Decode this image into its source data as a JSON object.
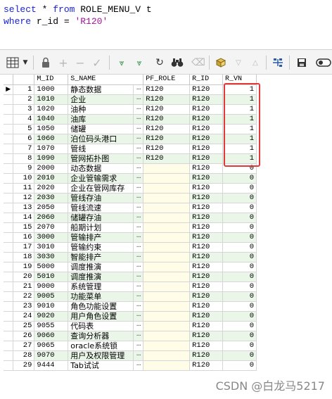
{
  "editor": {
    "line1": {
      "kw1": "select",
      "mid": " * ",
      "kw2": "from",
      "rest": " ROLE_MENU_V t"
    },
    "line2": {
      "kw1": "where",
      "mid": " r_id = ",
      "str": "'R120'"
    }
  },
  "toolbar": {
    "icons": [
      "grid-icon",
      "lock-icon",
      "add-row-icon",
      "delete-row-icon",
      "post-icon",
      "first-record-icon",
      "last-record-icon",
      "refresh-icon",
      "find-icon",
      "clear-icon",
      "export-icon",
      "move-down-icon",
      "move-up-icon",
      "query-plan-icon",
      "save-icon",
      "switch-icon"
    ]
  },
  "grid": {
    "columns": [
      "M_ID",
      "S_NAME",
      "PF_ROLE",
      "R_ID",
      "R_VN"
    ],
    "dots": "···",
    "rows": [
      {
        "n": "1",
        "m_id": "1000",
        "s_name": "静态数据",
        "pf_role": "R120",
        "r_id": "R120",
        "r_vn": "1"
      },
      {
        "n": "2",
        "m_id": "1010",
        "s_name": "企业",
        "pf_role": "R120",
        "r_id": "R120",
        "r_vn": "1"
      },
      {
        "n": "3",
        "m_id": "1020",
        "s_name": "油种",
        "pf_role": "R120",
        "r_id": "R120",
        "r_vn": "1"
      },
      {
        "n": "4",
        "m_id": "1040",
        "s_name": "油库",
        "pf_role": "R120",
        "r_id": "R120",
        "r_vn": "1"
      },
      {
        "n": "5",
        "m_id": "1050",
        "s_name": "储罐",
        "pf_role": "R120",
        "r_id": "R120",
        "r_vn": "1"
      },
      {
        "n": "6",
        "m_id": "1060",
        "s_name": "泊位码头港口",
        "pf_role": "R120",
        "r_id": "R120",
        "r_vn": "1"
      },
      {
        "n": "7",
        "m_id": "1070",
        "s_name": "管线",
        "pf_role": "R120",
        "r_id": "R120",
        "r_vn": "1"
      },
      {
        "n": "8",
        "m_id": "1090",
        "s_name": "管网拓扑图",
        "pf_role": "R120",
        "r_id": "R120",
        "r_vn": "1"
      },
      {
        "n": "9",
        "m_id": "2000",
        "s_name": "动态数据",
        "pf_role": "",
        "r_id": "R120",
        "r_vn": "0"
      },
      {
        "n": "10",
        "m_id": "2010",
        "s_name": "企业管输需求",
        "pf_role": "",
        "r_id": "R120",
        "r_vn": "0"
      },
      {
        "n": "11",
        "m_id": "2020",
        "s_name": "企业在管网库存",
        "pf_role": "",
        "r_id": "R120",
        "r_vn": "0"
      },
      {
        "n": "12",
        "m_id": "2030",
        "s_name": "管线存油",
        "pf_role": "",
        "r_id": "R120",
        "r_vn": "0"
      },
      {
        "n": "13",
        "m_id": "2050",
        "s_name": "管线流速",
        "pf_role": "",
        "r_id": "R120",
        "r_vn": "0"
      },
      {
        "n": "14",
        "m_id": "2060",
        "s_name": "储罐存油",
        "pf_role": "",
        "r_id": "R120",
        "r_vn": "0"
      },
      {
        "n": "15",
        "m_id": "2070",
        "s_name": "船期计划",
        "pf_role": "",
        "r_id": "R120",
        "r_vn": "0"
      },
      {
        "n": "16",
        "m_id": "3000",
        "s_name": "管输排产",
        "pf_role": "",
        "r_id": "R120",
        "r_vn": "0"
      },
      {
        "n": "17",
        "m_id": "3010",
        "s_name": "管输约束",
        "pf_role": "",
        "r_id": "R120",
        "r_vn": "0"
      },
      {
        "n": "18",
        "m_id": "3030",
        "s_name": "智能排产",
        "pf_role": "",
        "r_id": "R120",
        "r_vn": "0"
      },
      {
        "n": "19",
        "m_id": "5000",
        "s_name": "调度推演",
        "pf_role": "",
        "r_id": "R120",
        "r_vn": "0"
      },
      {
        "n": "20",
        "m_id": "5010",
        "s_name": "调度推演",
        "pf_role": "",
        "r_id": "R120",
        "r_vn": "0"
      },
      {
        "n": "21",
        "m_id": "9000",
        "s_name": "系统管理",
        "pf_role": "",
        "r_id": "R120",
        "r_vn": "0"
      },
      {
        "n": "22",
        "m_id": "9005",
        "s_name": "功能菜单",
        "pf_role": "",
        "r_id": "R120",
        "r_vn": "0"
      },
      {
        "n": "23",
        "m_id": "9010",
        "s_name": "角色功能设置",
        "pf_role": "",
        "r_id": "R120",
        "r_vn": "0"
      },
      {
        "n": "24",
        "m_id": "9020",
        "s_name": "用户角色设置",
        "pf_role": "",
        "r_id": "R120",
        "r_vn": "0"
      },
      {
        "n": "25",
        "m_id": "9055",
        "s_name": "代码表",
        "pf_role": "",
        "r_id": "R120",
        "r_vn": "0"
      },
      {
        "n": "26",
        "m_id": "9060",
        "s_name": "查询分析器",
        "pf_role": "",
        "r_id": "R120",
        "r_vn": "0"
      },
      {
        "n": "27",
        "m_id": "9065",
        "s_name": "oracle系统锁",
        "pf_role": "",
        "r_id": "R120",
        "r_vn": "0"
      },
      {
        "n": "28",
        "m_id": "9070",
        "s_name": "用户及权限管理",
        "pf_role": "",
        "r_id": "R120",
        "r_vn": "0"
      },
      {
        "n": "29",
        "m_id": "9444",
        "s_name": "Tab试试",
        "pf_role": "",
        "r_id": "R120",
        "r_vn": "0"
      }
    ]
  },
  "watermark": "CSDN @白龙马5217",
  "colors": {
    "highlight_box": "#e23a3a",
    "keyword": "#1a22d6",
    "string": "#a0149a",
    "row_tint": "#eaf6e8"
  }
}
